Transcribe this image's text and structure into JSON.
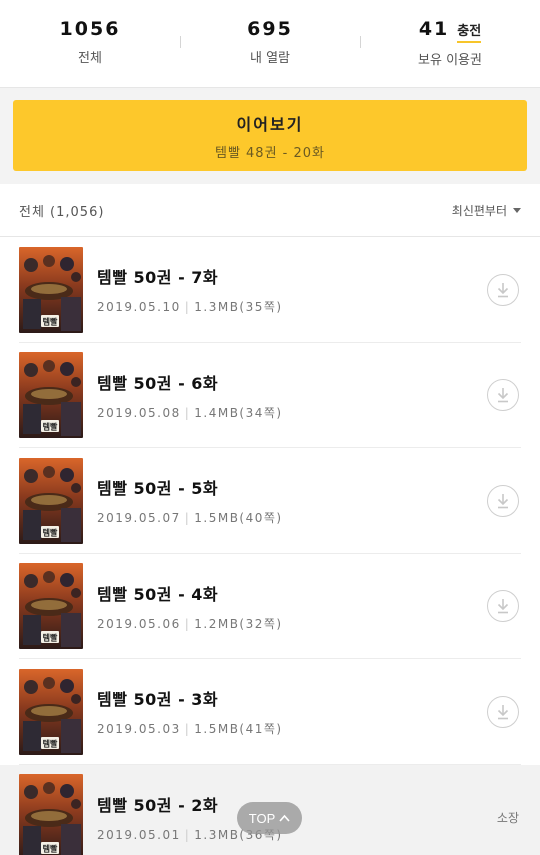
{
  "stats": [
    {
      "value": "1056",
      "label": "전체"
    },
    {
      "value": "695",
      "label": "내 열람"
    },
    {
      "value": "41",
      "label": "보유 이용권",
      "action": "충전"
    }
  ],
  "continue": {
    "title": "이어보기",
    "subtitle": "템빨 48권 - 20화"
  },
  "list_header": {
    "count": "전체 (1,056)",
    "sort": "최신편부터"
  },
  "episodes": [
    {
      "title": "템빨 50권 - 7화",
      "date": "2019.05.10",
      "size": "1.3MB(35쪽)",
      "status": "download"
    },
    {
      "title": "템빨 50권 - 6화",
      "date": "2019.05.08",
      "size": "1.4MB(34쪽)",
      "status": "download"
    },
    {
      "title": "템빨 50권 - 5화",
      "date": "2019.05.07",
      "size": "1.5MB(40쪽)",
      "status": "download"
    },
    {
      "title": "템빨 50권 - 4화",
      "date": "2019.05.06",
      "size": "1.2MB(32쪽)",
      "status": "download"
    },
    {
      "title": "템빨 50권 - 3화",
      "date": "2019.05.03",
      "size": "1.5MB(41쪽)",
      "status": "download"
    },
    {
      "title": "템빨 50권 - 2화",
      "date": "2019.05.01",
      "size": "1.3MB(36쪽)",
      "status": "owned",
      "badge": "소장"
    }
  ],
  "cover_art_text": "템빨",
  "top_button": "TOP",
  "colors": {
    "accent": "#fdc82b",
    "owned_row_bg": "#f2f2f2"
  }
}
